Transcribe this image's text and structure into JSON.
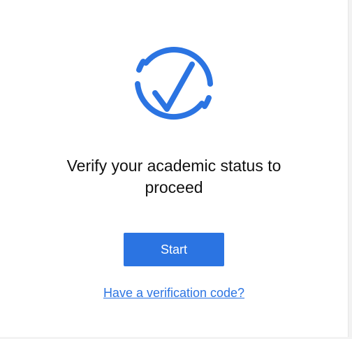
{
  "verification": {
    "icon": "verified-check-icon",
    "title": "Verify your academic status to proceed",
    "start_button_label": "Start",
    "code_link_text": "Have a verification code?"
  },
  "colors": {
    "accent": "#2b74e2",
    "text": "#111111",
    "background": "#ffffff"
  }
}
